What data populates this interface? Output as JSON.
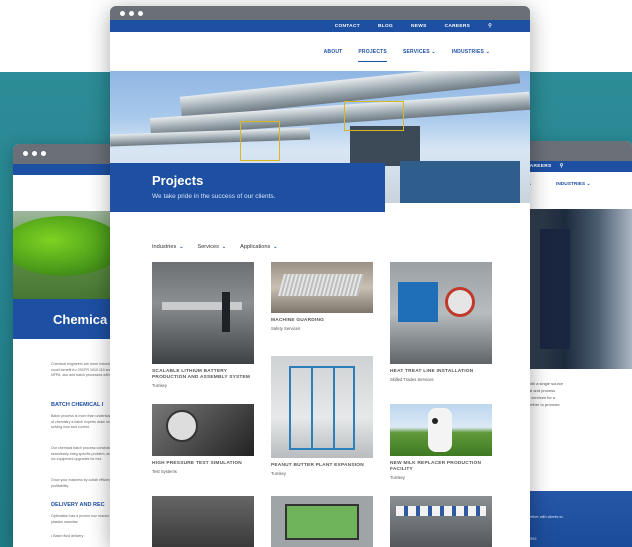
{
  "window_dots": [
    "dot",
    "dot",
    "dot"
  ],
  "utility_nav": [
    "CONTACT",
    "BLOG",
    "NEWS",
    "CAREERS"
  ],
  "main_nav": [
    {
      "label": "ABOUT",
      "active": false
    },
    {
      "label": "PROJECTS",
      "active": true
    },
    {
      "label": "SERVICES ⌄",
      "active": false
    },
    {
      "label": "INDUSTRIES ⌄",
      "active": false
    }
  ],
  "page": {
    "title": "Projects",
    "subtitle": "We take pride in the success of our clients."
  },
  "filters": [
    {
      "label": "Industries",
      "caret": "⌄"
    },
    {
      "label": "Services",
      "caret": "⌄"
    },
    {
      "label": "Applications",
      "caret": "⌄"
    }
  ],
  "projects": [
    {
      "title": "SCALABLE LITHIUM BATTERY PRODUCTION AND ASSEMBLY SYSTEM",
      "category": "Turnkey"
    },
    {
      "title": "MACHINE GUARDING",
      "category": "Safety Services"
    },
    {
      "title": "HEAT TREAT LINE INSTALLATION",
      "category": "Skilled Trades Services"
    },
    {
      "title": "HIGH PRESSURE TEST SIMULATION",
      "category": "Test Systems"
    },
    {
      "title": "PEANUT BUTTER PLANT EXPANSION",
      "category": "Turnkey"
    },
    {
      "title": "NEW MILK REPLACER PRODUCTION FACILITY",
      "category": "Turnkey"
    }
  ],
  "left_window": {
    "page_title": "Chemica",
    "intro": "Chemical engineers are more industry, you could benefit fro 29CFR 1910.119 and NFPA, dus and batch processes with a",
    "heading1": "BATCH CHEMICAL I",
    "para1": "Batch process is more than understanding of chemistry a batch experts draw on decad solving now and current.",
    "para2": "Our chemical batch process constraints, seamlessly integ specific problem, and we inc equipment upgrades for mul",
    "para3": "Grow your business by collab efficiency and profitability.",
    "heading2": "DELIVERY AND REC",
    "para4": "Optimation has a proven noz reactor at a plastics manufac",
    "bullet1": "• Batch fluid delivery"
  },
  "right_window": {
    "nav": [
      "CAREERS"
    ],
    "menu": [
      "ES ⌄",
      "INDUSTRIES ⌄"
    ],
    "text": [
      "with a single source",
      "tal and process",
      "e services for a",
      "gether to promote"
    ],
    "footer_text": "gether with clients to",
    "footer_small": "1993"
  }
}
